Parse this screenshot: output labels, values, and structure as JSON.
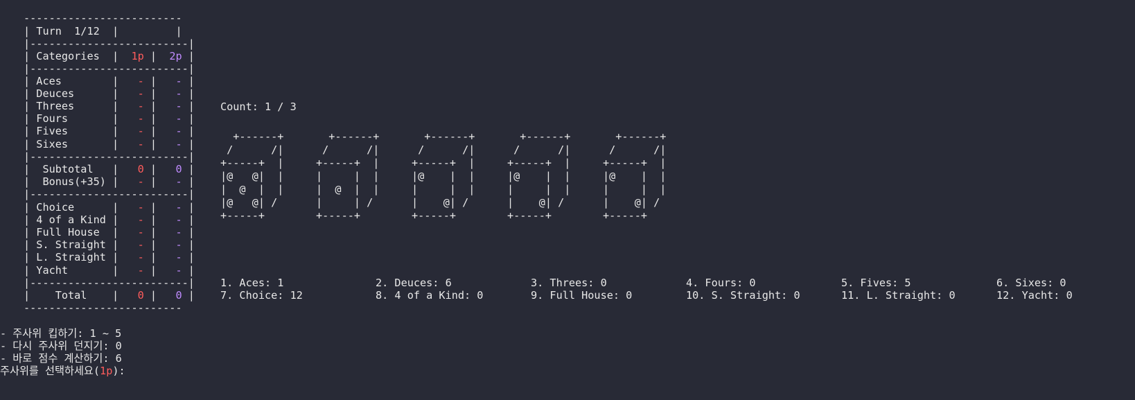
{
  "scoreboard": {
    "turn_label": "Turn  1/12",
    "categories_header": "Categories",
    "p1_label": "1p",
    "p2_label": "2p",
    "upper_rows": [
      {
        "name": "Aces",
        "p1": "-",
        "p2": "-"
      },
      {
        "name": "Deuces",
        "p1": "-",
        "p2": "-"
      },
      {
        "name": "Threes",
        "p1": "-",
        "p2": "-"
      },
      {
        "name": "Fours",
        "p1": "-",
        "p2": "-"
      },
      {
        "name": "Fives",
        "p1": "-",
        "p2": "-"
      },
      {
        "name": "Sixes",
        "p1": "-",
        "p2": "-"
      }
    ],
    "subtotal": {
      "name": "Subtotal",
      "p1": "0",
      "p2": "0"
    },
    "bonus": {
      "name": "Bonus(+35)",
      "p1": "-",
      "p2": "-"
    },
    "lower_rows": [
      {
        "name": "Choice",
        "p1": "-",
        "p2": "-"
      },
      {
        "name": "4 of a Kind",
        "p1": "-",
        "p2": "-"
      },
      {
        "name": "Full House",
        "p1": "-",
        "p2": "-"
      },
      {
        "name": "S. Straight",
        "p1": "-",
        "p2": "-"
      },
      {
        "name": "L. Straight",
        "p1": "-",
        "p2": "-"
      },
      {
        "name": "Yacht",
        "p1": "-",
        "p2": "-"
      }
    ],
    "total": {
      "name": "Total",
      "p1": "0",
      "p2": "0"
    }
  },
  "roll_count": "Count: 1 / 3",
  "dice": [
    {
      "face": 5,
      "art": "  +------+\n /      /|\n+-----+  |\n|@   @|  |\n|  @  |  |\n|@   @| /\n+-----+"
    },
    {
      "face": 1,
      "art": "  +------+\n /      /|\n+-----+  |\n|     |  |\n|  @  |  |\n|     | /\n+-----+"
    },
    {
      "face": 2,
      "art": "  +------+\n /      /|\n+-----+  |\n|@    |  |\n|     |  |\n|    @| /\n+-----+"
    },
    {
      "face": 2,
      "art": "  +------+\n /      /|\n+-----+  |\n|@    |  |\n|     |  |\n|    @| /\n+-----+"
    },
    {
      "face": 2,
      "art": "  +------+\n /      /|\n+-----+  |\n|@    |  |\n|     |  |\n|    @| /\n+-----+"
    }
  ],
  "score_options": {
    "row1": [
      "1. Aces: 1",
      "2. Deuces: 6",
      "3. Threes: 0",
      "4. Fours: 0",
      "5. Fives: 5",
      "6. Sixes: 0"
    ],
    "row2": [
      "7. Choice: 12",
      "8. 4 of a Kind: 0",
      "9. Full House: 0",
      "10. S. Straight: 0",
      "11. L. Straight: 0",
      "12. Yacht: 0"
    ]
  },
  "instructions": {
    "keep_dice": "- 주사위 킵하기: 1 ~ 5",
    "reroll": "- 다시 주사위 던지기: 0",
    "score_now": "- 바로 점수 계산하기: 6",
    "prompt_prefix": "주사위를 선택하세요(",
    "prompt_player": "1p",
    "prompt_suffix": "):"
  },
  "colors": {
    "background": "#282a36",
    "text": "#e8e8e8",
    "player1": "#ff5c5c",
    "player2": "#c08cff"
  }
}
